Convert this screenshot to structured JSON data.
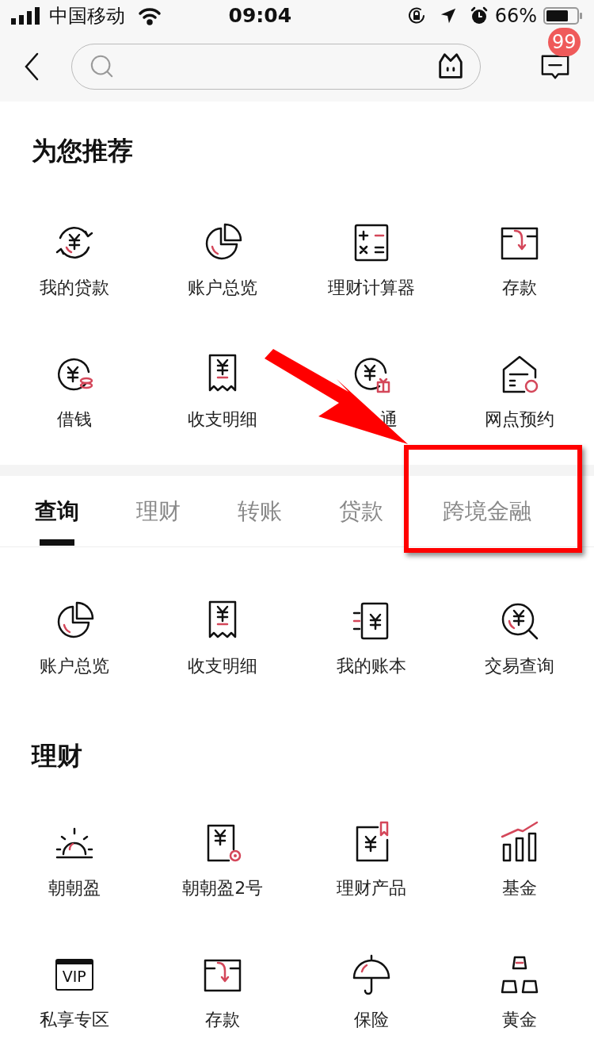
{
  "status_bar": {
    "carrier": "中国移动",
    "time": "09:04",
    "battery": "66%"
  },
  "header": {
    "badge": "99"
  },
  "recommend": {
    "title": "为您推荐",
    "items": [
      {
        "label": "我的贷款",
        "kind": "loan"
      },
      {
        "label": "账户总览",
        "kind": "overview"
      },
      {
        "label": "理财计算器",
        "kind": "calculator"
      },
      {
        "label": "存款",
        "kind": "deposit"
      },
      {
        "label": "借钱",
        "kind": "borrow"
      },
      {
        "label": "收支明细",
        "kind": "receipt"
      },
      {
        "label": "通",
        "kind": "gift"
      },
      {
        "label": "网点预约",
        "kind": "branch"
      }
    ]
  },
  "tabs": [
    {
      "label": "查询",
      "selected": true
    },
    {
      "label": "理财",
      "selected": false
    },
    {
      "label": "转账",
      "selected": false
    },
    {
      "label": "贷款",
      "selected": false
    },
    {
      "label": "跨境金融",
      "selected": false
    }
  ],
  "query": {
    "items": [
      {
        "label": "账户总览",
        "kind": "overview"
      },
      {
        "label": "收支明细",
        "kind": "receipt"
      },
      {
        "label": "我的账本",
        "kind": "ledger"
      },
      {
        "label": "交易查询",
        "kind": "search"
      }
    ]
  },
  "wealth": {
    "title": "理财",
    "items": [
      {
        "label": "朝朝盈",
        "kind": "sunrise"
      },
      {
        "label": "朝朝盈2号",
        "kind": "target"
      },
      {
        "label": "理财产品",
        "kind": "bookmark"
      },
      {
        "label": "基金",
        "kind": "fund"
      },
      {
        "label": "私享专区",
        "kind": "vip",
        "icon_text": "VIP"
      },
      {
        "label": "存款",
        "kind": "deposit"
      },
      {
        "label": "保险",
        "kind": "umbrella"
      },
      {
        "label": "黄金",
        "kind": "gold"
      }
    ]
  },
  "annotations": {
    "arrow": true,
    "highlight_frame": true
  }
}
